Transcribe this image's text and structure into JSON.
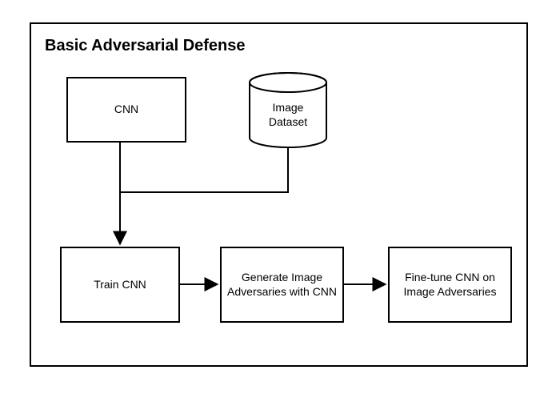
{
  "title": "Basic Adversarial Defense",
  "nodes": {
    "cnn": {
      "label": "CNN"
    },
    "dataset": {
      "label1": "Image",
      "label2": "Dataset"
    },
    "train": {
      "label": "Train CNN"
    },
    "generate": {
      "label": "Generate Image Adversaries with CNN"
    },
    "finetune": {
      "label": "Fine-tune CNN on Image Adversaries"
    }
  }
}
